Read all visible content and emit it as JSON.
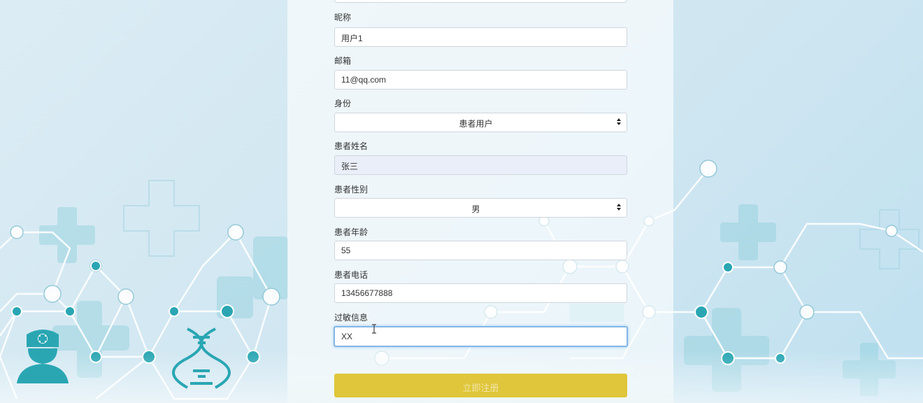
{
  "form": {
    "fields": [
      {
        "label": "昵称",
        "value": "用户1",
        "type": "text"
      },
      {
        "label": "邮箱",
        "value": "11@qq.com",
        "type": "text"
      },
      {
        "label": "身份",
        "value": "患者用户",
        "type": "select"
      },
      {
        "label": "患者姓名",
        "value": "张三",
        "type": "text",
        "readonly": true
      },
      {
        "label": "患者性别",
        "value": "男",
        "type": "select"
      },
      {
        "label": "患者年龄",
        "value": "55",
        "type": "text"
      },
      {
        "label": "患者电话",
        "value": "13456677888",
        "type": "text"
      },
      {
        "label": "过敏信息",
        "value": "XX",
        "type": "text",
        "focused": true
      }
    ],
    "submit_label": "立即注册"
  },
  "colors": {
    "accent_button": "#dfc63a",
    "focus_border": "#84b6e6",
    "background_teal": "#2aa6b3"
  },
  "icons": [
    "doctor-icon",
    "dna-icon",
    "medical-cross-icon",
    "molecule-network-icon"
  ]
}
